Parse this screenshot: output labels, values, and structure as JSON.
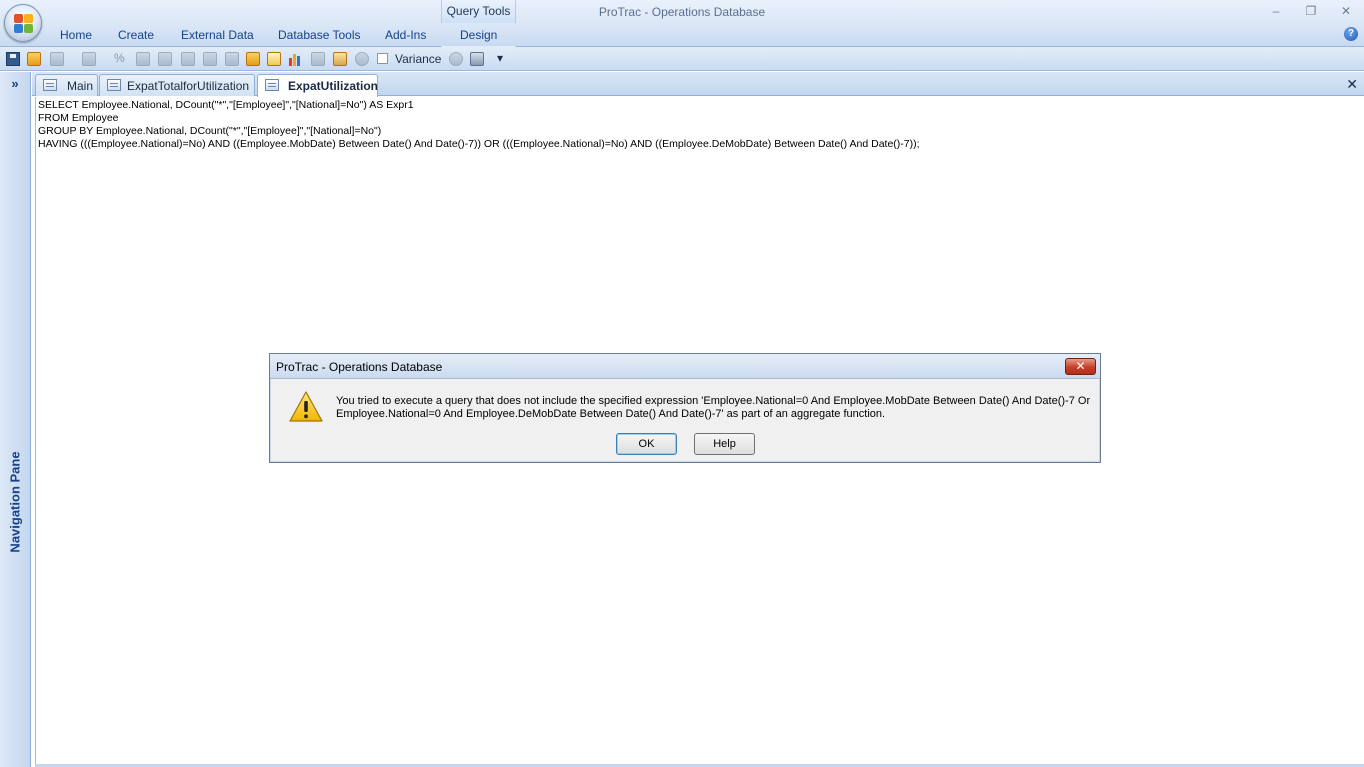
{
  "window": {
    "app_title": "ProTrac - Operations Database",
    "context_tab_group": "Query Tools",
    "controls": {
      "minimize": "–",
      "restore": "❐",
      "close": "✕"
    }
  },
  "ribbon": {
    "tabs": [
      "Home",
      "Create",
      "External Data",
      "Database Tools",
      "Add-Ins",
      "Design"
    ],
    "help_glyph": "?"
  },
  "toolbar": {
    "variance_label": "Variance",
    "variance_checked": false,
    "percent_glyph": "%",
    "dropdown_glyph": "▾"
  },
  "nav_pane": {
    "label": "Navigation Pane",
    "toggle_glyph": "»"
  },
  "document_tabs": {
    "tabs": [
      "Main",
      "ExpatTotalforUtilization",
      "ExpatUtilization"
    ],
    "active": "ExpatUtilization",
    "close_glyph": "✕"
  },
  "sql": {
    "lines": [
      "SELECT Employee.National, DCount(\"*\",\"[Employee]\",\"[National]=No\") AS Expr1",
      "FROM Employee",
      "GROUP BY Employee.National, DCount(\"*\",\"[Employee]\",\"[National]=No\")",
      "HAVING (((Employee.National)=No) AND ((Employee.MobDate) Between Date() And Date()-7)) OR (((Employee.National)=No) AND ((Employee.DeMobDate) Between Date() And Date()-7));"
    ]
  },
  "dialog": {
    "title": "ProTrac - Operations Database",
    "close_glyph": "✕",
    "message": "You tried to execute a query that does not include the specified expression 'Employee.National=0 And Employee.MobDate Between Date() And Date()-7 Or Employee.National=0 And Employee.DeMobDate Between Date() And Date()-7' as part of an aggregate function.",
    "ok_label": "OK",
    "help_label": "Help",
    "icon": "warning-icon"
  }
}
